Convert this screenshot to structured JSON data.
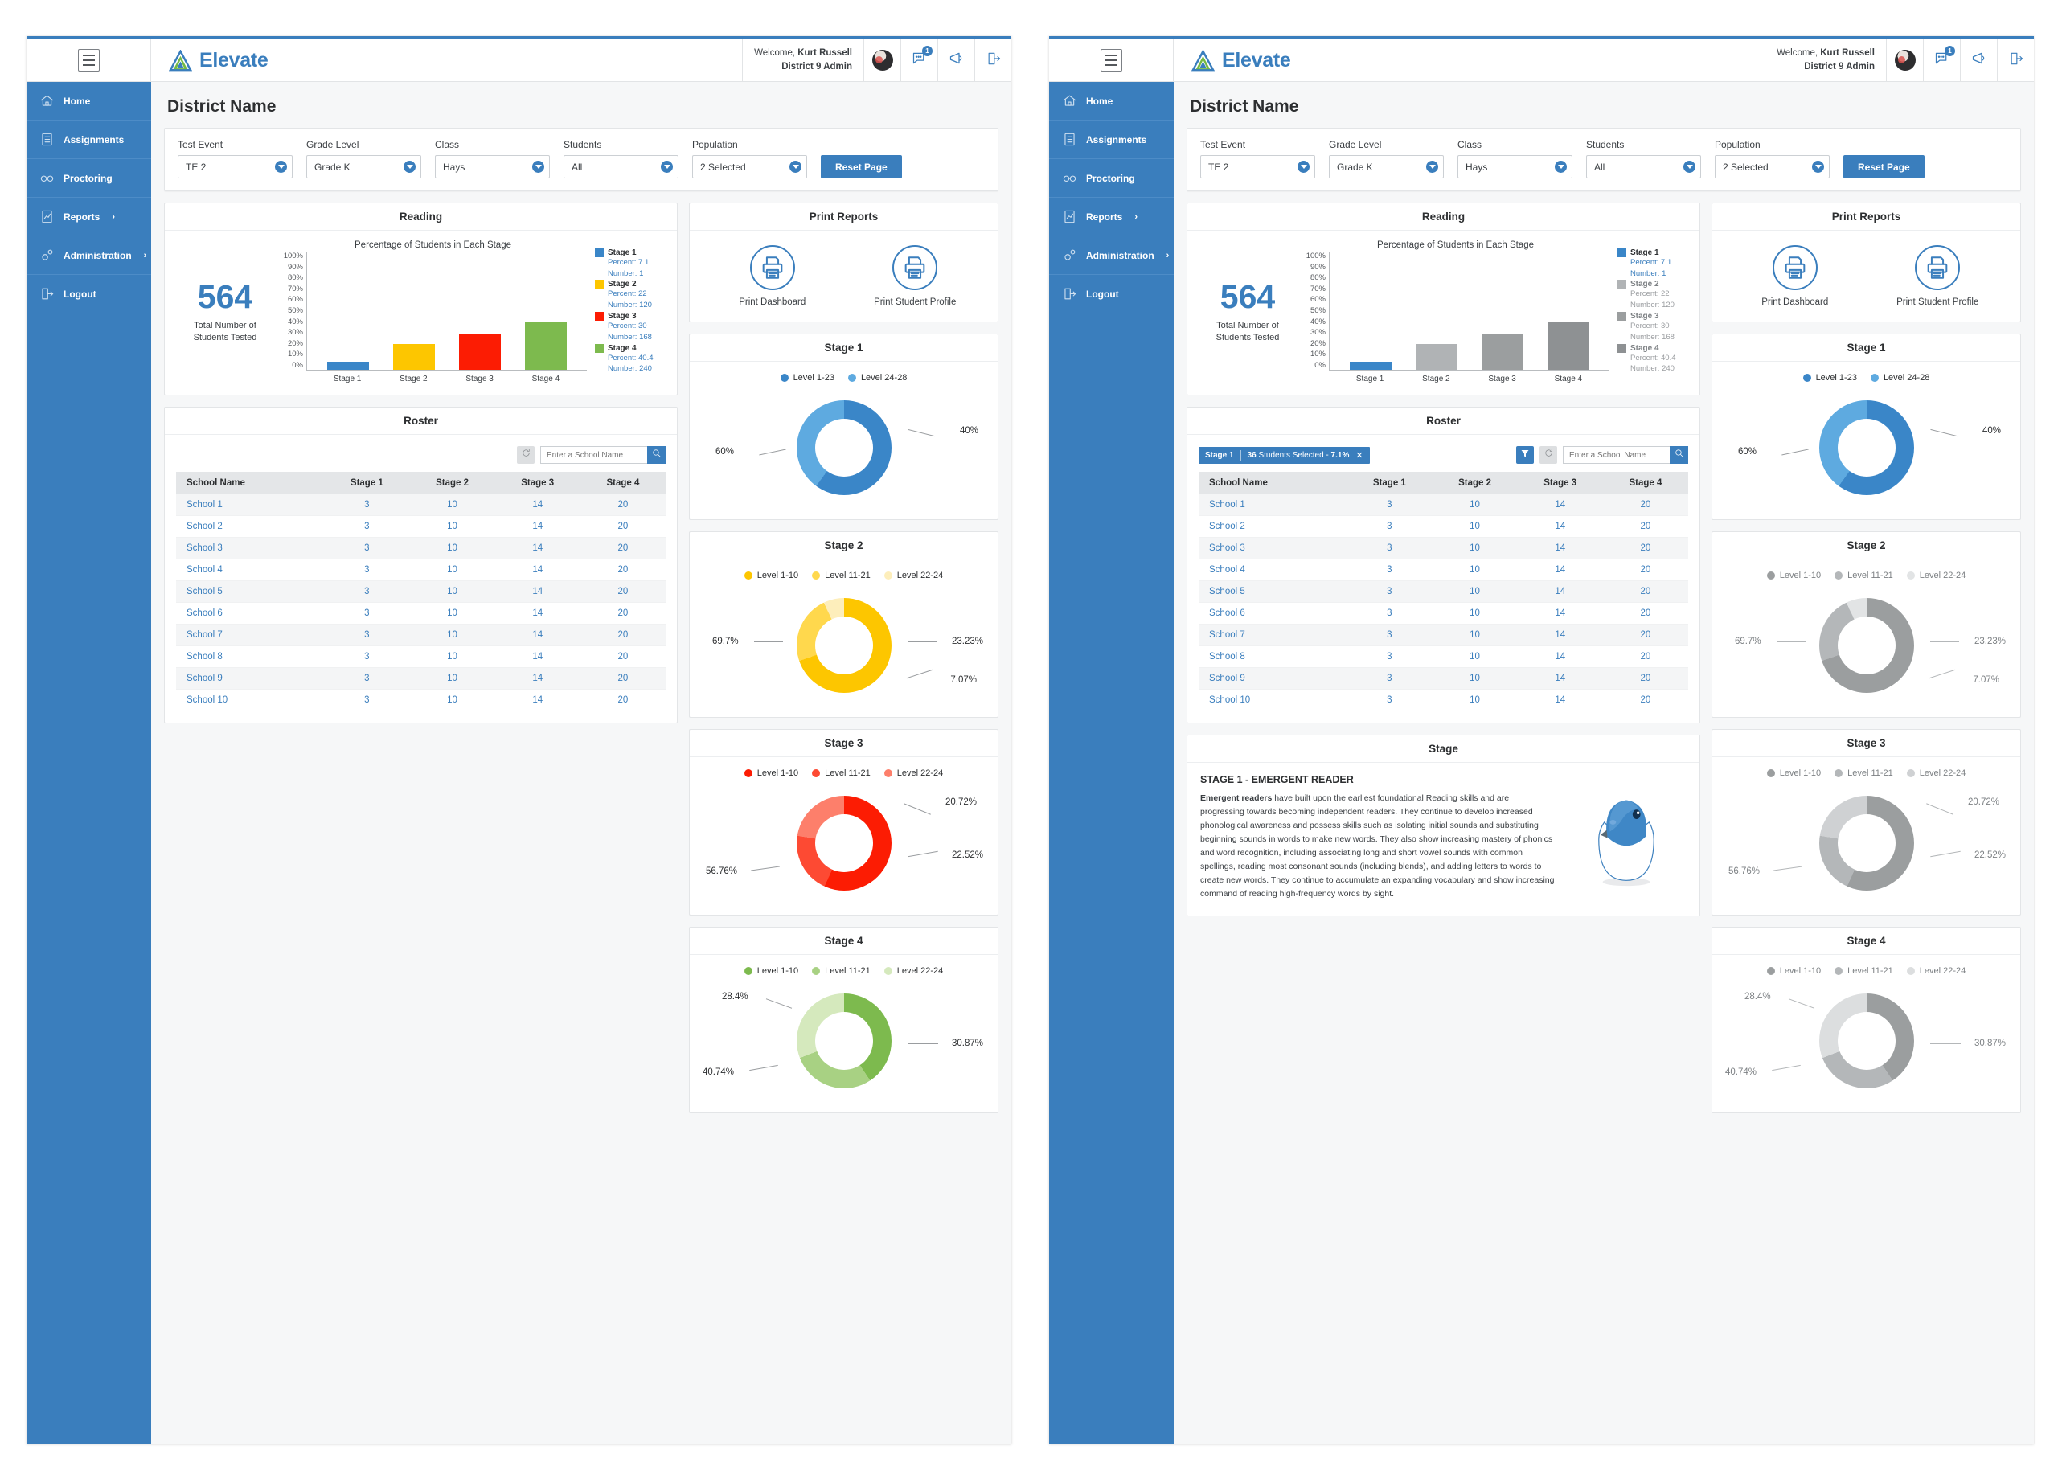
{
  "app": {
    "brand": "Elevate",
    "menu_icon": "hamburger-icon",
    "welcome_line1_prefix": "Welcome, ",
    "welcome_name": "Kurt Russell",
    "welcome_role": "District 9 Admin",
    "notification_count": "1"
  },
  "sidebar": {
    "items": [
      {
        "label": "Home",
        "icon": "home-icon",
        "chevron": ""
      },
      {
        "label": "Assignments",
        "icon": "clipboard-icon",
        "chevron": ""
      },
      {
        "label": "Proctoring",
        "icon": "glasses-icon",
        "chevron": ""
      },
      {
        "label": "Reports",
        "icon": "report-icon",
        "chevron": "›"
      },
      {
        "label": "Administration",
        "icon": "settings-icon",
        "chevron": "›"
      },
      {
        "label": "Logout",
        "icon": "logout-icon",
        "chevron": ""
      }
    ]
  },
  "page": {
    "title": "District Name"
  },
  "filters": {
    "reset_label": "Reset Page",
    "items": [
      {
        "label": "Test Event",
        "value": "TE 2"
      },
      {
        "label": "Grade Level",
        "value": "Grade K"
      },
      {
        "label": "Class",
        "value": "Hays"
      },
      {
        "label": "Students",
        "value": "All"
      },
      {
        "label": "Population",
        "value": "2 Selected"
      }
    ]
  },
  "reading": {
    "title": "Reading",
    "kpi_value": "564",
    "kpi_label": "Total Number of\nStudents Tested",
    "kpi_label_l1": "Total Number of",
    "kpi_label_l2": "Students Tested"
  },
  "roster": {
    "title": "Roster",
    "search_placeholder": "Enter a School Name",
    "refresh_icon": "refresh-icon",
    "filter_icon": "funnel-icon",
    "search_icon": "search-icon",
    "chip": {
      "stage": "Stage 1",
      "count": "36",
      "text": " Students Selected - ",
      "percent": "7.1%",
      "close": "✕"
    },
    "columns": [
      "School Name",
      "Stage 1",
      "Stage 2",
      "Stage 3",
      "Stage 4"
    ],
    "rows": [
      {
        "name": "School 1",
        "s1": "3",
        "s2": "10",
        "s3": "14",
        "s4": "20"
      },
      {
        "name": "School 2",
        "s1": "3",
        "s2": "10",
        "s3": "14",
        "s4": "20"
      },
      {
        "name": "School 3",
        "s1": "3",
        "s2": "10",
        "s3": "14",
        "s4": "20"
      },
      {
        "name": "School 4",
        "s1": "3",
        "s2": "10",
        "s3": "14",
        "s4": "20"
      },
      {
        "name": "School 5",
        "s1": "3",
        "s2": "10",
        "s3": "14",
        "s4": "20"
      },
      {
        "name": "School 6",
        "s1": "3",
        "s2": "10",
        "s3": "14",
        "s4": "20"
      },
      {
        "name": "School 7",
        "s1": "3",
        "s2": "10",
        "s3": "14",
        "s4": "20"
      },
      {
        "name": "School 8",
        "s1": "3",
        "s2": "10",
        "s3": "14",
        "s4": "20"
      },
      {
        "name": "School 9",
        "s1": "3",
        "s2": "10",
        "s3": "14",
        "s4": "20"
      },
      {
        "name": "School 10",
        "s1": "3",
        "s2": "10",
        "s3": "14",
        "s4": "20"
      }
    ]
  },
  "print_reports": {
    "title": "Print Reports",
    "items": [
      {
        "label": "Print Dashboard",
        "icon": "printer-icon"
      },
      {
        "label": "Print Student Profile",
        "icon": "printer-icon"
      }
    ]
  },
  "stage_panel": {
    "title": "Stage",
    "heading": "STAGE 1 - EMERGENT READER",
    "lead": "Emergent readers",
    "body": " have built upon the earliest foundational Reading skills and are progressing towards becoming independent readers. They continue to develop increased phonological awareness and possess skills such as isolating initial sounds and substituting beginning sounds in words to make new words. They also show increasing mastery of phonics and word recognition, including associating long and short vowel sounds with common spellings, reading most consonant sounds (including blends), and adding letters to words to create new words. They continue to accumulate an expanding vocabulary and show increasing command of reading high-frequency words by sight.",
    "art": "hatching-chick-icon"
  },
  "colors": {
    "brand_blue": "#3a7ebd",
    "stage1": "#3a86c8",
    "stage1_light": "#5eaae0",
    "stage2": "#fdc600",
    "stage2_mid": "#ffd84d",
    "stage2_light": "#fdeebb",
    "stage3": "#fc1c03",
    "stage3_mid": "#fd4a33",
    "stage3_light": "#fd7f6b",
    "stage4": "#7dba4e",
    "stage4_mid": "#a8d183",
    "stage4_light": "#d5e9bd",
    "grey_dark": "#9b9e9f",
    "grey_mid": "#b4b7b9",
    "grey_light": "#e2e4e5",
    "grey_bar_2": "#b0b3b5",
    "grey_bar_3": "#9b9e9f",
    "grey_bar_4": "#8e9193"
  },
  "chart_data": [
    {
      "type": "bar",
      "id": "reading-stage-distribution",
      "title": "Percentage of Students in Each Stage",
      "panel_title": "Reading",
      "xlabel": "",
      "ylabel": "",
      "ylim": [
        0,
        100
      ],
      "ytick_labels": [
        "100%",
        "90%",
        "80%",
        "70%",
        "60%",
        "50%",
        "40%",
        "30%",
        "20%",
        "10%",
        "0%"
      ],
      "categories": [
        "Stage 1",
        "Stage 2",
        "Stage 3",
        "Stage 4"
      ],
      "values": [
        7.1,
        22,
        30,
        40.4
      ],
      "bar_colors": [
        "#3a86c8",
        "#fdc600",
        "#fc1c03",
        "#7dba4e"
      ],
      "bar_colors_muted": [
        "#3a86c8",
        "#b0b3b5",
        "#9b9e9f",
        "#8e9193"
      ],
      "legend_position": "right",
      "legend": [
        {
          "name": "Stage 1",
          "percent_label": "Percent: 7.1",
          "number_label": "Number: 1"
        },
        {
          "name": "Stage 2",
          "percent_label": "Percent: 22",
          "number_label": "Number: 120"
        },
        {
          "name": "Stage 3",
          "percent_label": "Percent: 30",
          "number_label": "Number: 168"
        },
        {
          "name": "Stage 4",
          "percent_label": "Percent: 40.4",
          "number_label": "Number: 240"
        }
      ]
    },
    {
      "type": "pie",
      "id": "stage-1-donut",
      "title": "Stage 1",
      "labels": [
        "Level 1-23",
        "Level 24-28"
      ],
      "values": [
        60,
        40
      ],
      "value_labels": [
        "60%",
        "40%"
      ],
      "colors": [
        "#3a86c8",
        "#5eaae0"
      ],
      "colors_muted": [
        "#3a86c8",
        "#5eaae0"
      ],
      "donut": true
    },
    {
      "type": "pie",
      "id": "stage-2-donut",
      "title": "Stage 2",
      "labels": [
        "Level 1-10",
        "Level 11-21",
        "Level 22-24"
      ],
      "values": [
        69.7,
        23.23,
        7.07
      ],
      "value_labels": [
        "69.7%",
        "23.23%",
        "7.07%"
      ],
      "colors": [
        "#fdc600",
        "#ffd84d",
        "#fdeebb"
      ],
      "colors_muted": [
        "#9b9e9f",
        "#b4b7b9",
        "#e2e4e5"
      ],
      "donut": true
    },
    {
      "type": "pie",
      "id": "stage-3-donut",
      "title": "Stage 3",
      "labels": [
        "Level 1-10",
        "Level 11-21",
        "Level 22-24"
      ],
      "values": [
        56.76,
        20.72,
        22.52
      ],
      "value_labels": [
        "56.76%",
        "20.72%",
        "22.52%"
      ],
      "colors": [
        "#fc1c03",
        "#fd4a33",
        "#fd7f6b"
      ],
      "colors_muted": [
        "#9b9e9f",
        "#b4b7b9",
        "#cfd1d3"
      ],
      "donut": true
    },
    {
      "type": "pie",
      "id": "stage-4-donut",
      "title": "Stage 4",
      "labels": [
        "Level 1-10",
        "Level 11-21",
        "Level 22-24"
      ],
      "values": [
        40.74,
        28.4,
        30.87
      ],
      "value_labels": [
        "40.74%",
        "28.4%",
        "30.87%"
      ],
      "colors": [
        "#7dba4e",
        "#a8d183",
        "#d5e9bd"
      ],
      "colors_muted": [
        "#9b9e9f",
        "#b4b7b9",
        "#dcdedf"
      ],
      "donut": true
    }
  ]
}
